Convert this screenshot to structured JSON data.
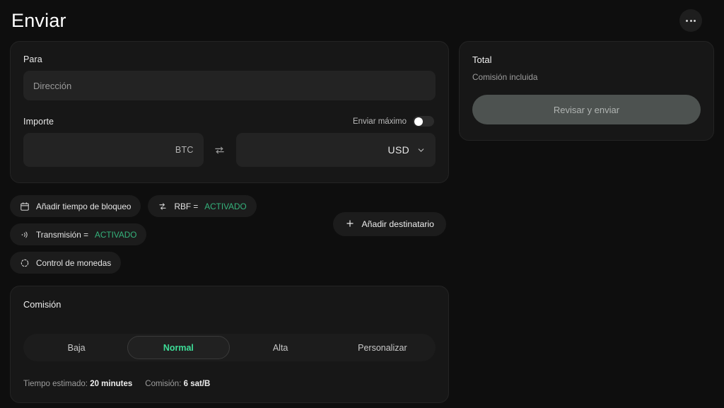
{
  "header": {
    "title": "Enviar",
    "more_button_label": "···"
  },
  "send_form": {
    "recipient": {
      "label": "Para",
      "placeholder": "Dirección",
      "value": ""
    },
    "amount": {
      "label": "Importe",
      "max_toggle_label": "Enviar máximo",
      "max_toggle_state": "off",
      "primary_input": {
        "value": "",
        "unit": "BTC"
      },
      "secondary_input": {
        "value": "",
        "unit": "USD"
      },
      "swap_icon": "swap-icon",
      "currency_chevron_icon": "chevron-down-icon"
    },
    "options": [
      {
        "icon": "calendar-icon",
        "label": "Añadir tiempo de bloqueo",
        "state": ""
      },
      {
        "icon": "rbf-swap-icon",
        "label": "RBF =",
        "state": "ACTIVADO"
      },
      {
        "icon": "broadcast-icon",
        "label": "Transmisión =",
        "state": "ACTIVADO"
      },
      {
        "icon": "coin-control-icon",
        "label": "Control de monedas",
        "state": ""
      }
    ],
    "add_recipient": {
      "icon": "plus-icon",
      "label": "Añadir destinatario"
    }
  },
  "fee": {
    "title": "Comisión",
    "options": [
      {
        "label": "Baja",
        "active": false
      },
      {
        "label": "Normal",
        "active": true
      },
      {
        "label": "Alta",
        "active": false
      },
      {
        "label": "Personalizar",
        "active": false
      }
    ],
    "estimate_label": "Tiempo estimado:",
    "estimate_value": "20 minutes",
    "rate_label": "Comisión:",
    "rate_value": "6 sat/B"
  },
  "total": {
    "title": "Total",
    "subtitle": "Comisión incluida",
    "submit_label": "Revisar y enviar",
    "submit_enabled": false
  },
  "colors": {
    "page_background": "#0e0e0e",
    "card_background": "#171717",
    "input_background": "#232323",
    "accent_green": "#35b37c",
    "active_green": "#3ddc97",
    "disabled_button": "#4d5250"
  }
}
